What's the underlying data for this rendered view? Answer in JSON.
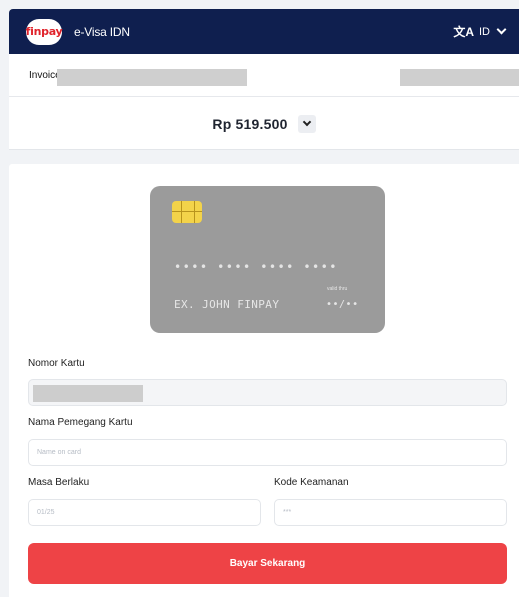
{
  "header": {
    "logo_text": "finpay",
    "title": "e-Visa IDN",
    "language_icon": "translate-icon",
    "language_icon_glyph": "文A",
    "language_code": "ID"
  },
  "invoice": {
    "label": "Invoice"
  },
  "payment": {
    "amount": "Rp 519.500"
  },
  "card_preview": {
    "number": "•••• •••• •••• ••••",
    "holder": "EX. JOHN FINPAY",
    "valid_label": "valid thru",
    "expiry": "••/••"
  },
  "form": {
    "card_number_label": "Nomor Kartu",
    "cardholder_label": "Nama Pemegang Kartu",
    "cardholder_placeholder": "Name on card",
    "expiry_label": "Masa Berlaku",
    "expiry_placeholder": "01/25",
    "cvv_label": "Kode Keamanan",
    "cvv_placeholder": "***",
    "submit_label": "Bayar Sekarang"
  },
  "colors": {
    "header_bg": "#0f1f4f",
    "accent_red": "#ee4346",
    "card_bg": "#9b9b9b",
    "chip": "#f3d34a"
  }
}
